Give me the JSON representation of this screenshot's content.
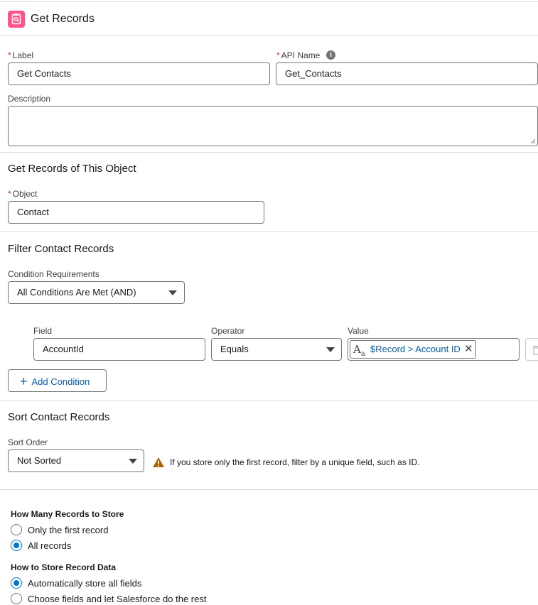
{
  "header": {
    "title": "Get Records",
    "icon": "get-records-icon",
    "icon_color": "#ff538a"
  },
  "general": {
    "label_label": "Label",
    "label_value": "Get Contacts",
    "api_name_label": "API Name",
    "api_name_value": "Get_Contacts",
    "description_label": "Description",
    "description_value": ""
  },
  "object_section": {
    "title": "Get Records of This Object",
    "object_label": "Object",
    "object_value": "Contact"
  },
  "filter": {
    "title": "Filter Contact Records",
    "requirements_label": "Condition Requirements",
    "requirements_value": "All Conditions Are Met (AND)",
    "field_header": "Field",
    "operator_header": "Operator",
    "value_header": "Value",
    "condition": {
      "field": "AccountId",
      "operator": "Equals",
      "value_pill": "$Record > Account ID"
    },
    "add_condition_label": "Add Condition"
  },
  "sort": {
    "title": "Sort Contact Records",
    "order_label": "Sort Order",
    "order_value": "Not Sorted",
    "warning": "If you store only the first record, filter by a unique field, such as ID."
  },
  "store": {
    "how_many_title": "How Many Records to Store",
    "only_first": "Only the first record",
    "all_records": "All records",
    "how_title": "How to Store Record Data",
    "auto_store": "Automatically store all fields",
    "choose_fields": "Choose fields and let Salesforce do the rest"
  },
  "colors": {
    "accent": "#0176d3",
    "link": "#0b5cab",
    "required": "#c23934",
    "warning": "#a96404"
  }
}
